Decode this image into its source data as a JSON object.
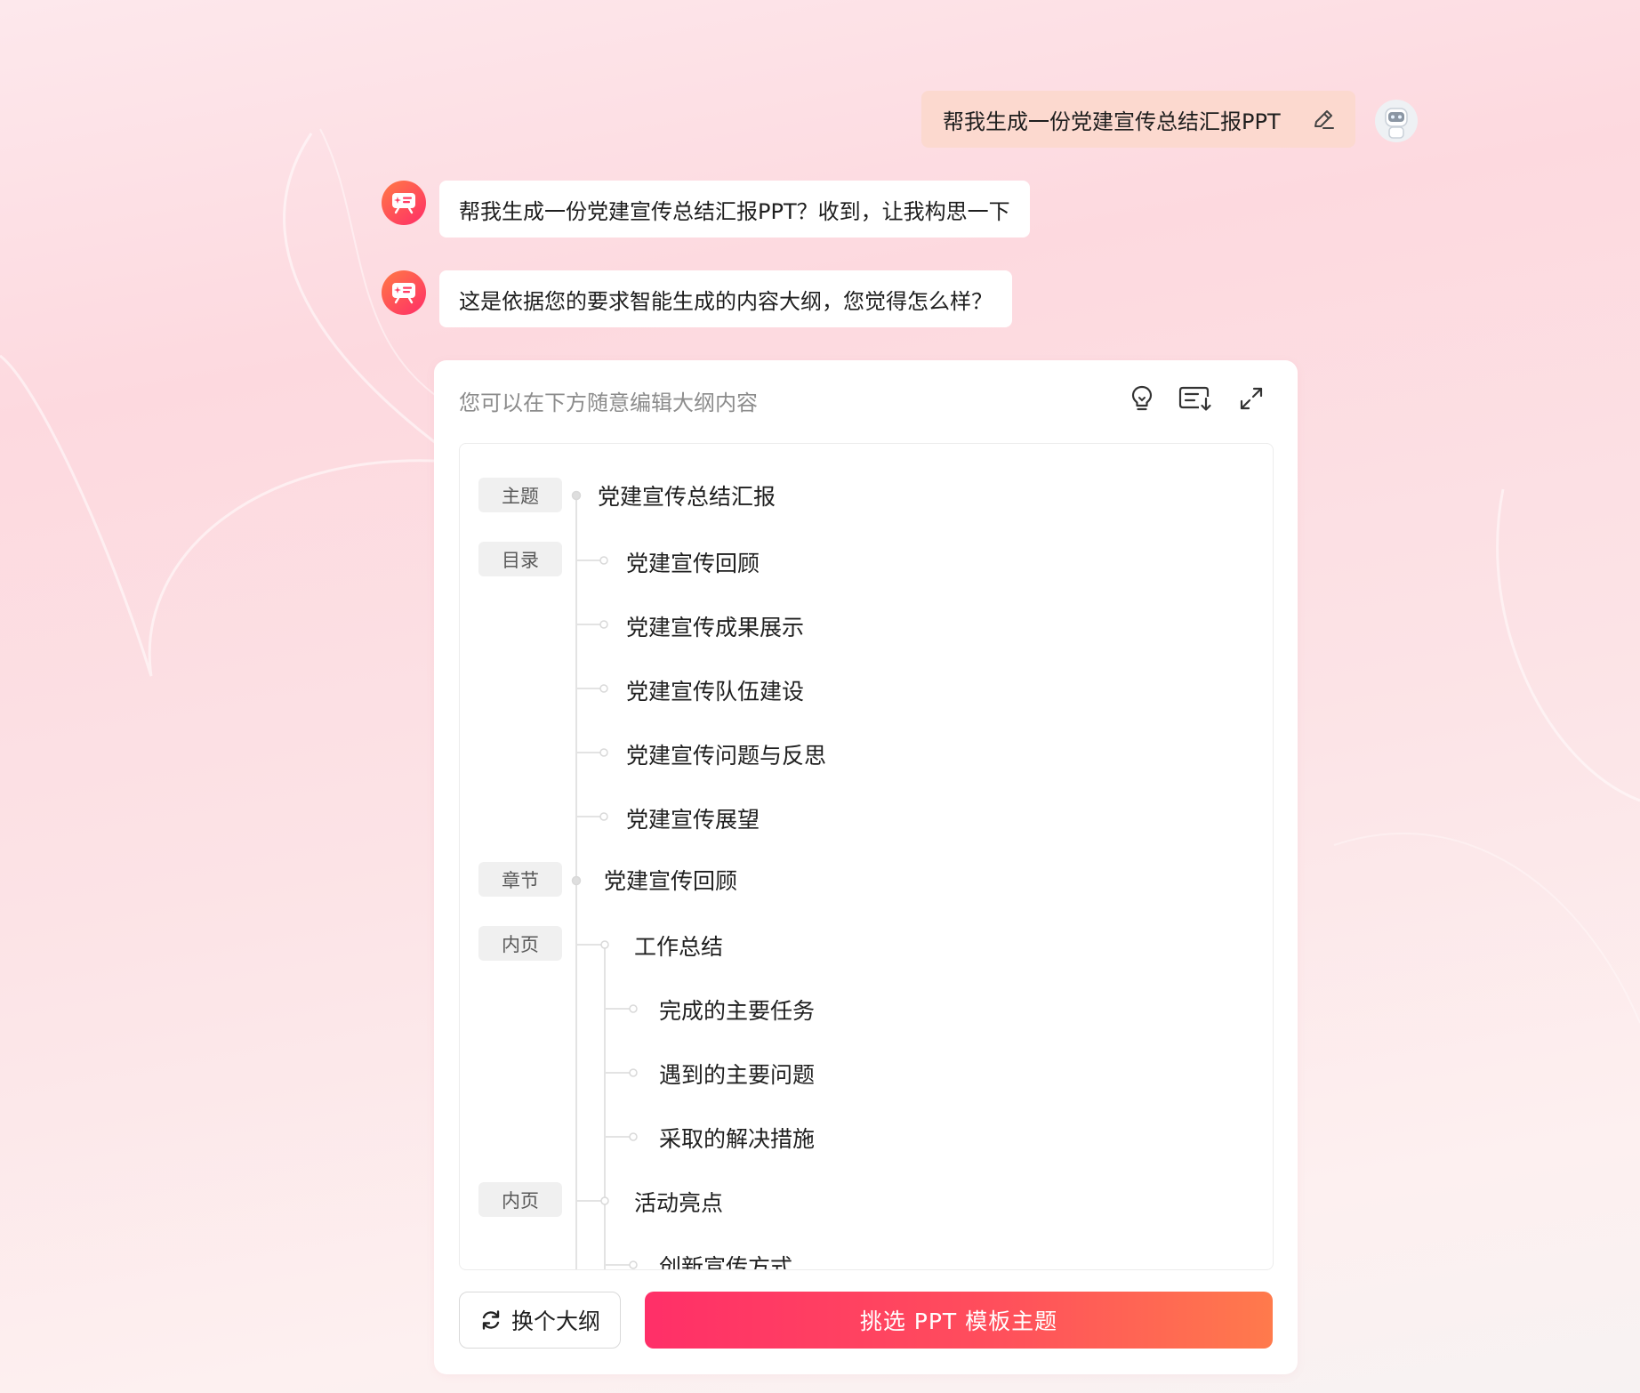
{
  "user_message": {
    "text": "帮我生成一份党建宣传总结汇报PPT"
  },
  "bot_messages": [
    {
      "text": "帮我生成一份党建宣传总结汇报PPT？收到，让我构思一下"
    },
    {
      "text": "这是依据您的要求智能生成的内容大纲，您觉得怎么样？"
    }
  ],
  "outline_card": {
    "hint": "您可以在下方随意编辑大纲内容",
    "tags": {
      "theme": "主题",
      "toc": "目录",
      "chapter": "章节",
      "inner_page": "内页"
    },
    "theme_title": "党建宣传总结汇报",
    "toc_items": [
      "党建宣传回顾",
      "党建宣传成果展示",
      "党建宣传队伍建设",
      "党建宣传问题与反思",
      "党建宣传展望"
    ],
    "chapter_title": "党建宣传回顾",
    "pages": [
      {
        "title": "工作总结",
        "points": [
          "完成的主要任务",
          "遇到的主要问题",
          "采取的解决措施"
        ]
      },
      {
        "title": "活动亮点",
        "points": [
          "创新宣传方式"
        ]
      }
    ]
  },
  "actions": {
    "change_outline": "换个大纲",
    "pick_template": "挑选 PPT 模板主题"
  },
  "icons": {
    "edit": "pencil-icon",
    "idea": "lightbulb-icon",
    "export": "download-outline-icon",
    "expand": "expand-icon",
    "refresh": "refresh-icon"
  },
  "colors": {
    "accent_start": "#ff2f68",
    "accent_end": "#ff7a4c",
    "user_bubble": "#fcd9cf"
  }
}
